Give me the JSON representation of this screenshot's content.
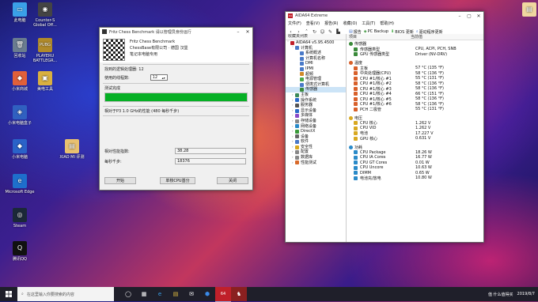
{
  "desktop": {
    "icons": [
      {
        "label": "此电脑",
        "glyph": "▭",
        "color": "#3aa0e8"
      },
      {
        "label": "Counter-S Global Off...",
        "glyph": "◉",
        "color": "#444"
      },
      {
        "label": "回收站",
        "glyph": "🗑",
        "color": "#6a7c90"
      },
      {
        "label": "PLAYERU BATTLEGR...",
        "glyph": "PUBG",
        "color": "#b08a2a"
      },
      {
        "label": "小米商城",
        "glyph": "◆",
        "color": "#e0603a"
      },
      {
        "label": "美电工具",
        "glyph": "▣",
        "color": "#d8b040"
      },
      {
        "label": "小米电脑盒子",
        "glyph": "◈",
        "color": "#3060c0"
      },
      {
        "label": "小米电脑",
        "glyph": "◆",
        "color": "#2a62c8"
      },
      {
        "label": "XIAO MI 评测",
        "glyph": "▤",
        "color": "#e8c070"
      },
      {
        "label": "Microsoft Edge",
        "glyph": "e",
        "color": "#1e6fcc"
      },
      {
        "label": "Steam",
        "glyph": "◎",
        "color": "#1b2838"
      },
      {
        "label": "腾讯QQ",
        "glyph": "Q",
        "color": "#111"
      },
      {
        "label": "",
        "glyph": "▤",
        "color": "#f0d7a0"
      }
    ]
  },
  "fritz": {
    "title": "Fritz Chess Benchmark 请以管理员身份运行",
    "app_name": "Fritz Chess Benchmark",
    "company": "ChessBase有限公司 · 德国 汉堡",
    "subtitle": "笔记本电脑专用",
    "processors_label": "找到的逻辑处理器: 12",
    "threads_label": "使用的线程数:",
    "threads_value": "12",
    "status": "测试完成",
    "progress": 1.0,
    "relative_label": "相对于P3 1.0 GHz的性能 (480 每秒千步)",
    "relative_value": "",
    "ratio_label": "相对性能指数:",
    "ratio_value": "38.28",
    "knodes_label": "每秒千步:",
    "knodes_value": "18376",
    "start_button": "开始",
    "single_cpu_button": "单核CPU基分",
    "close_button": "关闭"
  },
  "aida": {
    "title": "AIDA64 Extreme",
    "menu": [
      "文件(F)",
      "查看(V)",
      "报告(R)",
      "收藏(O)",
      "工具(T)",
      "帮助(H)"
    ],
    "toolbar": {
      "report": "报告",
      "backup": "PC Backup",
      "bios": "BIOS 更新",
      "driver": "驱动程序更新"
    },
    "tree_header": "收藏夹列表",
    "detail_header_field": "项目",
    "detail_header_value": "当前值",
    "tree": [
      {
        "label": "AIDA64 v5.95.4500",
        "indent": 0,
        "color": "#c0202a"
      },
      {
        "label": "计算机",
        "indent": 1,
        "color": "#4a7ac8"
      },
      {
        "label": "系统概述",
        "indent": 2,
        "color": "#4a7ac8"
      },
      {
        "label": "计算机名称",
        "indent": 2,
        "color": "#4a7ac8"
      },
      {
        "label": "DMI",
        "indent": 2,
        "color": "#4a7ac8"
      },
      {
        "label": "IPMI",
        "indent": 2,
        "color": "#4a7ac8"
      },
      {
        "label": "超频",
        "indent": 2,
        "color": "#d08a2a"
      },
      {
        "label": "电源管理",
        "indent": 2,
        "color": "#4aa84a"
      },
      {
        "label": "便携式计算机",
        "indent": 2,
        "color": "#4a7ac8"
      },
      {
        "label": "传感器",
        "indent": 2,
        "color": "#3a8a3a"
      },
      {
        "label": "主板",
        "indent": 1,
        "color": "#3a8a5a"
      },
      {
        "label": "操作系统",
        "indent": 1,
        "color": "#2a6ac8"
      },
      {
        "label": "服务器",
        "indent": 1,
        "color": "#555"
      },
      {
        "label": "显示设备",
        "indent": 1,
        "color": "#2a6ac8"
      },
      {
        "label": "多媒体",
        "indent": 1,
        "color": "#8a4ac8"
      },
      {
        "label": "存储设备",
        "indent": 1,
        "color": "#888"
      },
      {
        "label": "网络设备",
        "indent": 1,
        "color": "#2a8ac8"
      },
      {
        "label": "DirectX",
        "indent": 1,
        "color": "#3a9a3a"
      },
      {
        "label": "设备",
        "indent": 1,
        "color": "#666"
      },
      {
        "label": "软件",
        "indent": 1,
        "color": "#4a7ac8"
      },
      {
        "label": "安全性",
        "indent": 1,
        "color": "#d8a820"
      },
      {
        "label": "配置",
        "indent": 1,
        "color": "#888"
      },
      {
        "label": "数据库",
        "indent": 1,
        "color": "#888"
      },
      {
        "label": "性能测试",
        "indent": 1,
        "color": "#d86a2a"
      }
    ],
    "sections": [
      {
        "title": "传感器",
        "rows": [
          {
            "field": "传感器类型",
            "value": "CPU, ACPI, PCH, SNB"
          },
          {
            "field": "GPU 传感器类型",
            "value": "Driver (NV-DRV)"
          }
        ]
      },
      {
        "title": "温度",
        "rows": [
          {
            "field": "主板",
            "value": "57 °C (135 °F)"
          },
          {
            "field": "中央处理器(CPU)",
            "value": "58 °C (136 °F)"
          },
          {
            "field": "CPU #1/核心 #1",
            "value": "55 °C (131 °F)"
          },
          {
            "field": "CPU #1/核心 #2",
            "value": "58 °C (136 °F)"
          },
          {
            "field": "CPU #1/核心 #3",
            "value": "58 °C (136 °F)"
          },
          {
            "field": "CPU #1/核心 #4",
            "value": "66 °C (151 °F)"
          },
          {
            "field": "CPU #1/核心 #5",
            "value": "58 °C (136 °F)"
          },
          {
            "field": "CPU #1/核心 #6",
            "value": "58 °C (136 °F)"
          },
          {
            "field": "PCH 二极管",
            "value": "55 °C (131 °F)"
          }
        ]
      },
      {
        "title": "电压",
        "rows": [
          {
            "field": "CPU 核心",
            "value": "1.262 V"
          },
          {
            "field": "CPU VID",
            "value": "1.262 V"
          },
          {
            "field": "电池",
            "value": "17.227 V"
          },
          {
            "field": "GPU 核心",
            "value": "0.631 V"
          }
        ]
      },
      {
        "title": "功耗",
        "rows": [
          {
            "field": "CPU Package",
            "value": "18.26 W"
          },
          {
            "field": "CPU IA Cores",
            "value": "16.77 W"
          },
          {
            "field": "CPU GT Cores",
            "value": "0.01 W"
          },
          {
            "field": "CPU Uncore",
            "value": "10.63 W"
          },
          {
            "field": "DIMM",
            "value": "0.65 W"
          },
          {
            "field": "电池充/放电",
            "value": "10.80 W"
          }
        ]
      }
    ]
  },
  "taskbar": {
    "search_placeholder": "在这里输入你要搜索的内容",
    "apps": [
      "◯",
      "▦",
      "e",
      "▤",
      "✉",
      "⬢",
      "64",
      "♞"
    ],
    "active_index": 6,
    "tray_time": "2019/8/7",
    "watermark": "值 什么值得买"
  }
}
